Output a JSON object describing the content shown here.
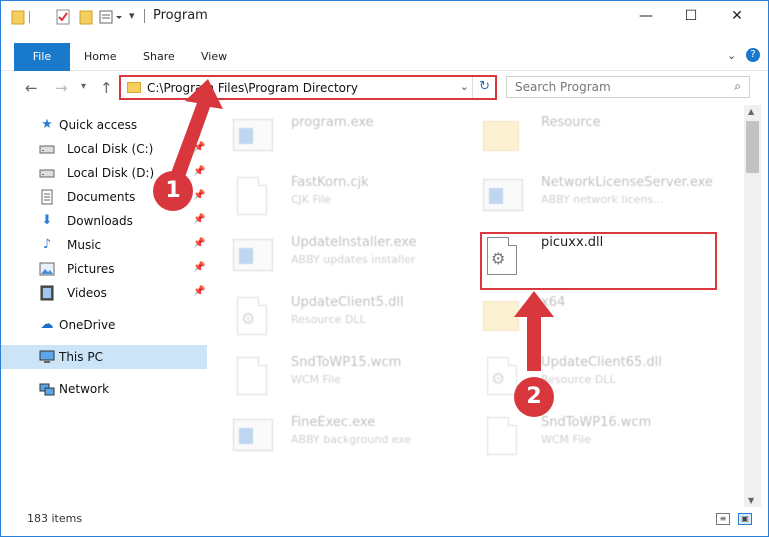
{
  "window": {
    "title": "Program",
    "controls": {
      "minimize": "—",
      "maximize": "☐",
      "close": "✕"
    }
  },
  "ribbon": {
    "tabs": [
      "File",
      "Home",
      "Share",
      "View"
    ],
    "expand": "⌄",
    "help": "?"
  },
  "address": {
    "path": "C:\\Program Files\\Program Directory",
    "search_placeholder": "Search Program"
  },
  "nav": {
    "quick_access": "Quick access",
    "items": [
      {
        "label": "Local Disk (C:)",
        "icon": "drive-icon"
      },
      {
        "label": "Local Disk (D:)",
        "icon": "drive-icon"
      },
      {
        "label": "Documents",
        "icon": "documents-icon"
      },
      {
        "label": "Downloads",
        "icon": "downloads-icon"
      },
      {
        "label": "Music",
        "icon": "music-icon"
      },
      {
        "label": "Pictures",
        "icon": "pictures-icon"
      },
      {
        "label": "Videos",
        "icon": "videos-icon"
      }
    ],
    "onedrive": "OneDrive",
    "thispc": "This PC",
    "network": "Network"
  },
  "files": {
    "left": [
      {
        "name": "program.exe",
        "desc": ""
      },
      {
        "name": "FastKorn.cjk",
        "desc": "CJK File"
      },
      {
        "name": "UpdateInstaller.exe",
        "desc": "ABBY updates installer"
      },
      {
        "name": "UpdateClient5.dll",
        "desc": "Resource DLL"
      },
      {
        "name": "SndToWP15.wcm",
        "desc": "WCM File"
      },
      {
        "name": "FineExec.exe",
        "desc": "ABBY background exe"
      }
    ],
    "right": [
      {
        "name": "Resource",
        "desc": ""
      },
      {
        "name": "NetworkLicenseServer.exe",
        "desc": "ABBY network licens..."
      },
      {
        "name": "picuxx.dll",
        "desc": ""
      },
      {
        "name": "x64",
        "desc": ""
      },
      {
        "name": "UpdateClient65.dll",
        "desc": "Resource DLL"
      },
      {
        "name": "SndToWP16.wcm",
        "desc": "WCM File"
      }
    ]
  },
  "status": {
    "items": "183 items"
  },
  "annotations": {
    "step1": "1",
    "step2": "2",
    "color": "#d9373e"
  }
}
